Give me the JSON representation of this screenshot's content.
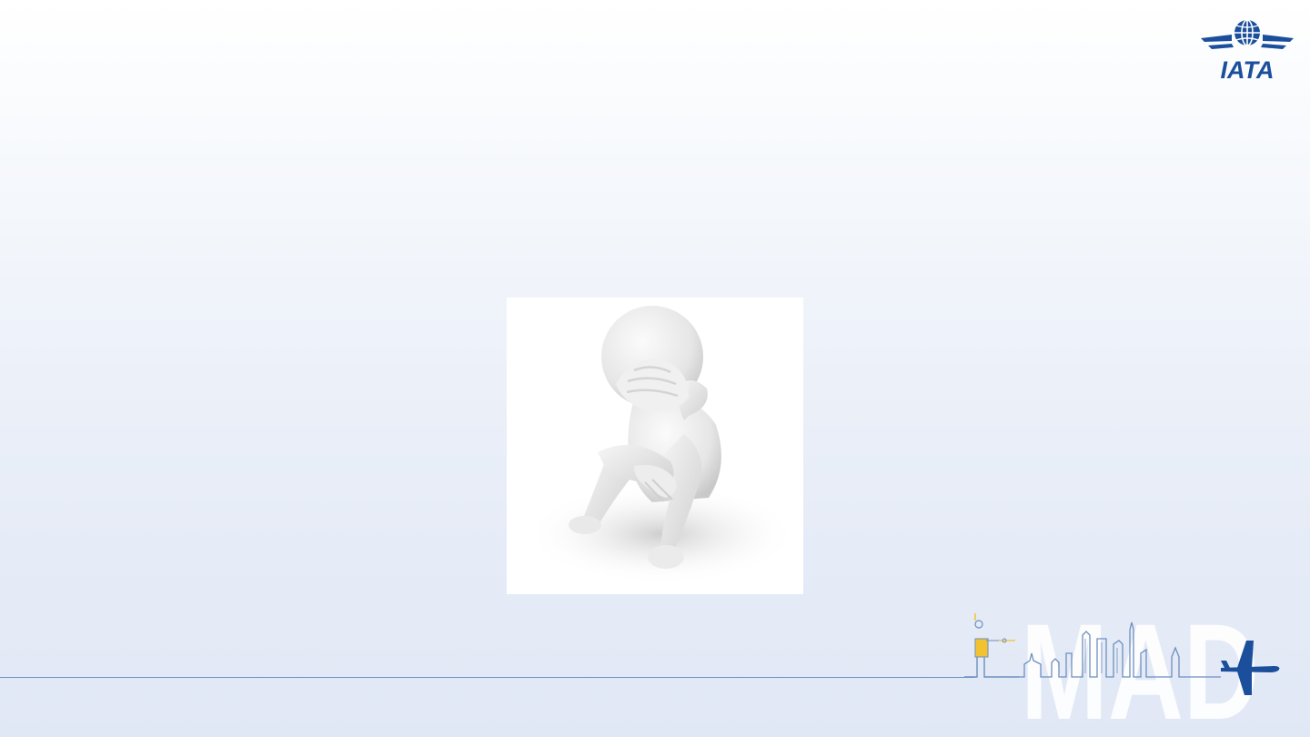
{
  "logo": {
    "text": "IATA",
    "icon": "globe-wings-icon",
    "color": "#1b4f9c"
  },
  "photo": {
    "icon": "sad-3d-person-icon"
  },
  "footer": {
    "city_code": "MAD",
    "skyline_icon": "madrid-skyline-icon",
    "plane_icon": "airplane-icon",
    "line_color": "#6d8fbf",
    "plane_color": "#1b4f9c",
    "accent_color": "#f2c230"
  }
}
